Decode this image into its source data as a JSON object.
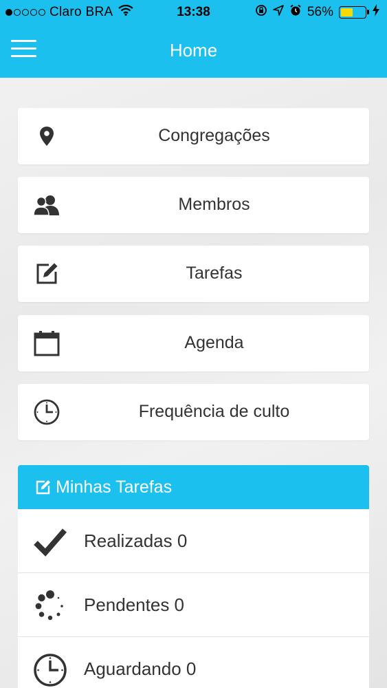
{
  "status_bar": {
    "carrier": "Claro BRA",
    "time": "13:38",
    "battery_percent": "56%",
    "battery_level": 0.56,
    "signal_bars_filled": 1,
    "signal_bars_total": 5
  },
  "header": {
    "title": "Home",
    "menu_icon": "hamburger-icon",
    "color": "#1cc0ef"
  },
  "menu": [
    {
      "label": "Congregações",
      "icon": "map-pin-icon"
    },
    {
      "label": "Membros",
      "icon": "users-icon"
    },
    {
      "label": "Tarefas",
      "icon": "edit-icon"
    },
    {
      "label": "Agenda",
      "icon": "calendar-icon"
    },
    {
      "label": "Frequência de culto",
      "icon": "clock-icon"
    }
  ],
  "tasks": {
    "title": "Minhas Tarefas",
    "title_icon": "edit-icon",
    "items": [
      {
        "label": "Realizadas 0",
        "icon": "checkmark-icon"
      },
      {
        "label": "Pendentes 0",
        "icon": "spinner-icon"
      },
      {
        "label": "Aguardando 0",
        "icon": "clock-icon"
      }
    ]
  }
}
